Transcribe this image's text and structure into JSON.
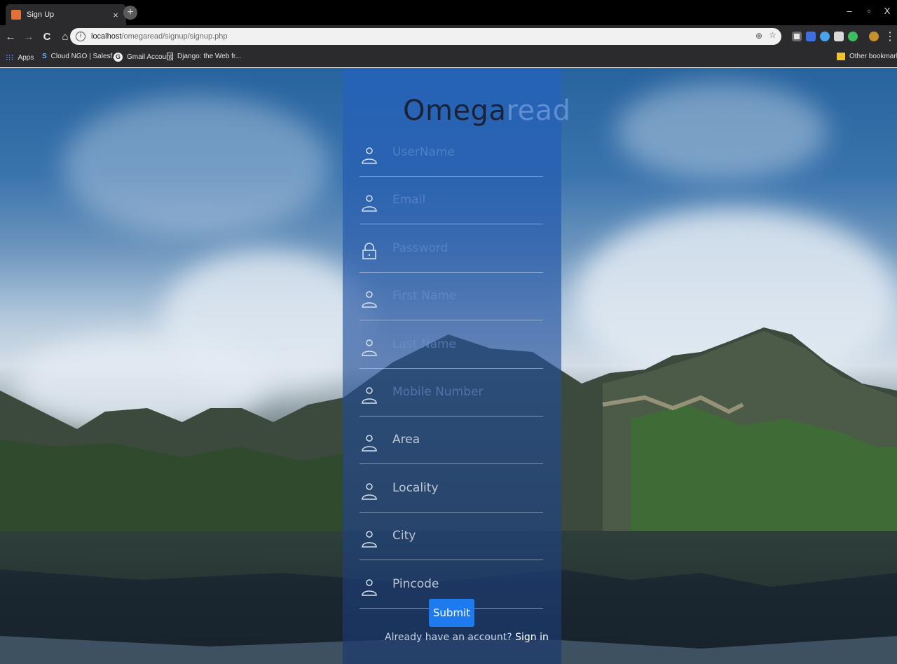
{
  "browser": {
    "tab_title": "Sign Up",
    "tab_close": "×",
    "new_tab": "+",
    "window_controls": [
      "–",
      "▫",
      "X"
    ],
    "nav": {
      "back": "←",
      "forward": "→",
      "reload": "C",
      "home": "⌂"
    },
    "url": {
      "host": "localhost",
      "path": "/omegaread/signup/signup.php"
    },
    "bookmarks": [
      {
        "label": "Apps",
        "icon": "apps-grid-icon"
      },
      {
        "label": "Cloud NGO | Salesf...",
        "icon": "salesforce-icon"
      },
      {
        "label": "Gmail Account",
        "icon": "google-icon"
      },
      {
        "label": "Django: the Web fr...",
        "icon": "page-icon"
      }
    ],
    "other_bookmarks": "Other bookmarks"
  },
  "brand": {
    "part1": "Omega",
    "part2": "read"
  },
  "fields": [
    {
      "label": "UserName",
      "icon": "user-icon",
      "value_visible": false
    },
    {
      "label": "Email",
      "icon": "user-icon",
      "value_visible": false
    },
    {
      "label": "Password",
      "icon": "lock-icon",
      "value_visible": false
    },
    {
      "label": "First Name",
      "icon": "user-icon",
      "value_visible": false
    },
    {
      "label": "Last Name",
      "icon": "user-icon",
      "value_visible": false
    },
    {
      "label": "Mobile Number",
      "icon": "user-icon",
      "value_visible": false
    },
    {
      "label": "Area",
      "icon": "user-icon",
      "value_visible": true
    },
    {
      "label": "Locality",
      "icon": "user-icon",
      "value_visible": true
    },
    {
      "label": "City",
      "icon": "user-icon",
      "value_visible": true
    },
    {
      "label": "Pincode",
      "icon": "user-icon",
      "value_visible": true
    }
  ],
  "submit_label": "Submit",
  "signin_prompt": "Already have an account?",
  "signin_link": "Sign in",
  "colors": {
    "accent": "#1e7bef",
    "brand_dark": "#1a2238",
    "brand_light": "#5f8fd2"
  }
}
